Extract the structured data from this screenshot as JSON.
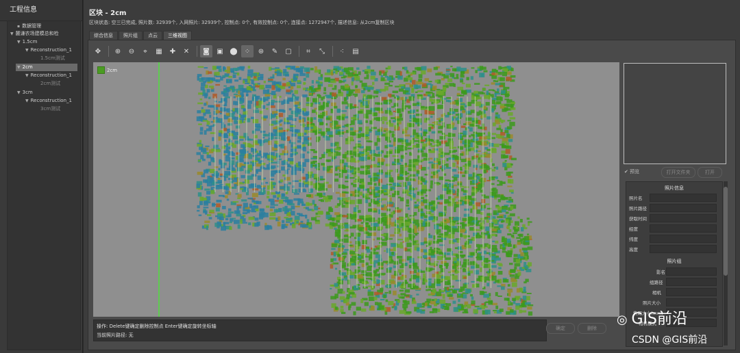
{
  "left": {
    "title": "工程信息",
    "tree": [
      {
        "label": "数据管理",
        "level": 1
      },
      {
        "label": "麓谦农场建模总和检",
        "level": 0
      },
      {
        "label": "1.5cm",
        "level": 1
      },
      {
        "label": "Reconstruction_1",
        "level": 2
      },
      {
        "label": "1.5cm测试",
        "level": 3
      },
      {
        "label": "2cm",
        "level": 1,
        "selected": true
      },
      {
        "label": "Reconstruction_1",
        "level": 2
      },
      {
        "label": "2cm测试",
        "level": 3
      },
      {
        "label": "3cm",
        "level": 1
      },
      {
        "label": "Reconstruction_1",
        "level": 2
      },
      {
        "label": "3cm测试",
        "level": 3
      }
    ]
  },
  "main": {
    "title": "区块 - 2cm",
    "status": "区块状态: 空三已完成, 照片数: 32939个, 入网照片: 32939个, 控制点: 0个, 有效控制点: 0个, 连接点: 1272947个, 描述信息: 从2cm复制区块",
    "tabs": [
      "综合信息",
      "照片组",
      "点云",
      "三维视图"
    ],
    "active_tab": "三维视图"
  },
  "toolbar": {
    "icons": [
      "pan-icon",
      "camera-add-icon",
      "camera-remove-icon",
      "crosshair-icon",
      "grid-icon",
      "point-add-icon",
      "axes-icon",
      "photo-icon",
      "image-frame-icon",
      "location-pin-icon",
      "tie-points-icon",
      "target-icon",
      "edit-icon",
      "square-icon",
      "crop-icon",
      "transform-icon",
      "scatter-icon",
      "picture-icon"
    ],
    "active": [
      "photo-icon",
      "tie-points-icon"
    ]
  },
  "viewport": {
    "legend_label": "2cm",
    "legend_color": "#4a9c22",
    "background": "#8f8f8f",
    "cloud_colors": [
      "#3c9a1c",
      "#6aa82a",
      "#2d8f8a",
      "#2a7fa0",
      "#9a8a2a",
      "#b05a28"
    ]
  },
  "message": {
    "line1": "操作: Delete键确定删除控制点 Enter键确定旋转坐标轴",
    "line2": "当前照片路径: 无"
  },
  "buttons": {
    "confirm": "确定",
    "delete": "删除"
  },
  "right": {
    "checkbox_label": "预览",
    "open_folder": "打开文件夹",
    "open": "打开",
    "photo_info_title": "照片信息",
    "photo_info": [
      "照片名",
      "照片路径",
      "获取时间",
      "经度",
      "纬度",
      "高度"
    ],
    "group_title": "照片组",
    "group_rows": [
      "影名",
      "组路径",
      "相机",
      "照片大小",
      "焦距大小(mm)",
      "相机模式"
    ]
  },
  "watermark": {
    "brand": "GIS前沿",
    "source": "CSDN @GIS前沿"
  }
}
